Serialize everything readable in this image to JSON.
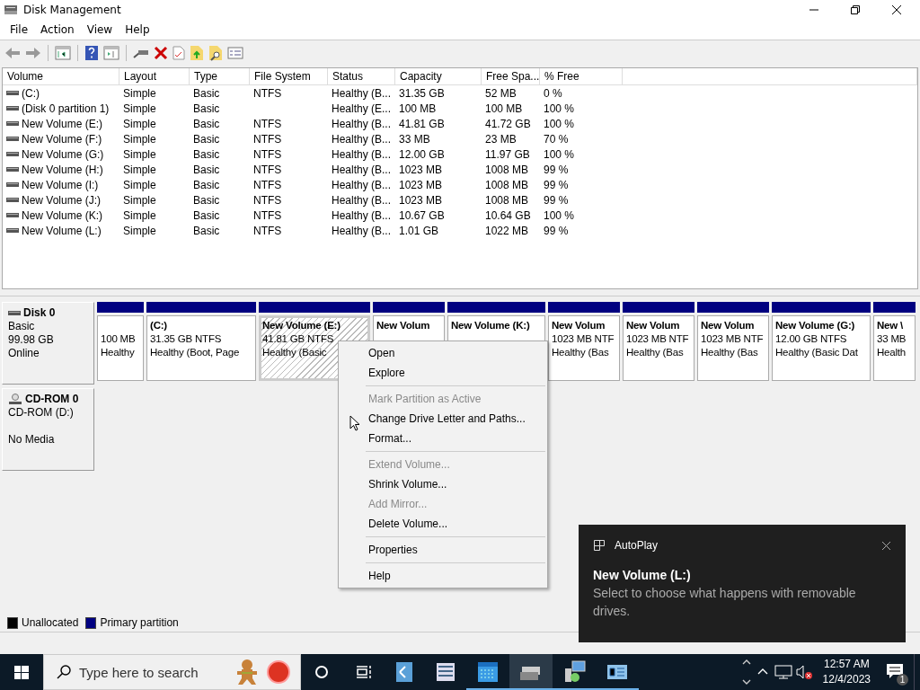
{
  "window": {
    "title": "Disk Management"
  },
  "menu": [
    "File",
    "Action",
    "View",
    "Help"
  ],
  "table": {
    "columns": [
      "Volume",
      "Layout",
      "Type",
      "File System",
      "Status",
      "Capacity",
      "Free Spa...",
      "% Free"
    ],
    "rows": [
      [
        "(C:)",
        "Simple",
        "Basic",
        "NTFS",
        "Healthy (B...",
        "31.35 GB",
        "52 MB",
        "0 %"
      ],
      [
        "(Disk 0 partition 1)",
        "Simple",
        "Basic",
        "",
        "Healthy (E...",
        "100 MB",
        "100 MB",
        "100 %"
      ],
      [
        "New Volume (E:)",
        "Simple",
        "Basic",
        "NTFS",
        "Healthy (B...",
        "41.81 GB",
        "41.72 GB",
        "100 %"
      ],
      [
        "New Volume (F:)",
        "Simple",
        "Basic",
        "NTFS",
        "Healthy (B...",
        "33 MB",
        "23 MB",
        "70 %"
      ],
      [
        "New Volume (G:)",
        "Simple",
        "Basic",
        "NTFS",
        "Healthy (B...",
        "12.00 GB",
        "11.97 GB",
        "100 %"
      ],
      [
        "New Volume (H:)",
        "Simple",
        "Basic",
        "NTFS",
        "Healthy (B...",
        "1023 MB",
        "1008 MB",
        "99 %"
      ],
      [
        "New Volume (I:)",
        "Simple",
        "Basic",
        "NTFS",
        "Healthy (B...",
        "1023 MB",
        "1008 MB",
        "99 %"
      ],
      [
        "New Volume (J:)",
        "Simple",
        "Basic",
        "NTFS",
        "Healthy (B...",
        "1023 MB",
        "1008 MB",
        "99 %"
      ],
      [
        "New Volume (K:)",
        "Simple",
        "Basic",
        "NTFS",
        "Healthy (B...",
        "10.67 GB",
        "10.64 GB",
        "100 %"
      ],
      [
        "New Volume (L:)",
        "Simple",
        "Basic",
        "NTFS",
        "Healthy (B...",
        "1.01 GB",
        "1022 MB",
        "99 %"
      ]
    ]
  },
  "disks": [
    {
      "kind": "disk",
      "name": "Disk 0",
      "type": "Basic",
      "size": "99.98 GB",
      "status": "Online",
      "partitions": [
        {
          "size": "100 MB",
          "status": "Healthy",
          "selected": false
        },
        {
          "title": "(C:)",
          "size": "31.35 GB NTFS",
          "status": "Healthy (Boot, Page",
          "selected": false
        },
        {
          "title": "New Volume  (E:)",
          "size": "41.81 GB NTFS",
          "status": "Healthy (Basic",
          "selected": true
        },
        {
          "title": "New Volum",
          "selected": false
        },
        {
          "title": "New Volume  (K:)",
          "selected": false
        },
        {
          "title": "New Volum",
          "size": "1023 MB NTF",
          "status": "Healthy (Bas",
          "selected": false
        },
        {
          "title": "New Volum",
          "size": "1023 MB NTF",
          "status": "Healthy (Bas",
          "selected": false
        },
        {
          "title": "New Volum",
          "size": "1023 MB NTF",
          "status": "Healthy (Bas",
          "selected": false
        },
        {
          "title": "New Volume  (G:)",
          "size": "12.00 GB NTFS",
          "status": "Healthy (Basic Dat",
          "selected": false
        },
        {
          "title": "New \\",
          "size": "33 MB",
          "status": "Health",
          "selected": false
        }
      ]
    },
    {
      "kind": "cdrom",
      "name": "CD-ROM 0",
      "type": "CD-ROM (D:)",
      "status": "No Media"
    }
  ],
  "legend": [
    {
      "label": "Unallocated",
      "color": "#000000"
    },
    {
      "label": "Primary partition",
      "color": "#000080"
    }
  ],
  "context_menu": [
    {
      "kind": "item",
      "label": "Open",
      "disabled": false
    },
    {
      "kind": "item",
      "label": "Explore",
      "disabled": false
    },
    {
      "kind": "separator"
    },
    {
      "kind": "item",
      "label": "Mark Partition as Active",
      "disabled": true
    },
    {
      "kind": "item",
      "label": "Change Drive Letter and Paths...",
      "disabled": false
    },
    {
      "kind": "item",
      "label": "Format...",
      "disabled": false
    },
    {
      "kind": "separator"
    },
    {
      "kind": "item",
      "label": "Extend Volume...",
      "disabled": true
    },
    {
      "kind": "item",
      "label": "Shrink Volume...",
      "disabled": false
    },
    {
      "kind": "item",
      "label": "Add Mirror...",
      "disabled": true
    },
    {
      "kind": "item",
      "label": "Delete Volume...",
      "disabled": false
    },
    {
      "kind": "separator"
    },
    {
      "kind": "item",
      "label": "Properties",
      "disabled": false
    },
    {
      "kind": "separator"
    },
    {
      "kind": "item",
      "label": "Help",
      "disabled": false
    }
  ],
  "toast": {
    "app": "AutoPlay",
    "title": "New Volume (L:)",
    "body": "Select to choose what happens with removable drives."
  },
  "taskbar": {
    "search_placeholder": "Type here to search",
    "time": "12:57 AM",
    "date": "12/4/2023",
    "notifications": "1"
  }
}
